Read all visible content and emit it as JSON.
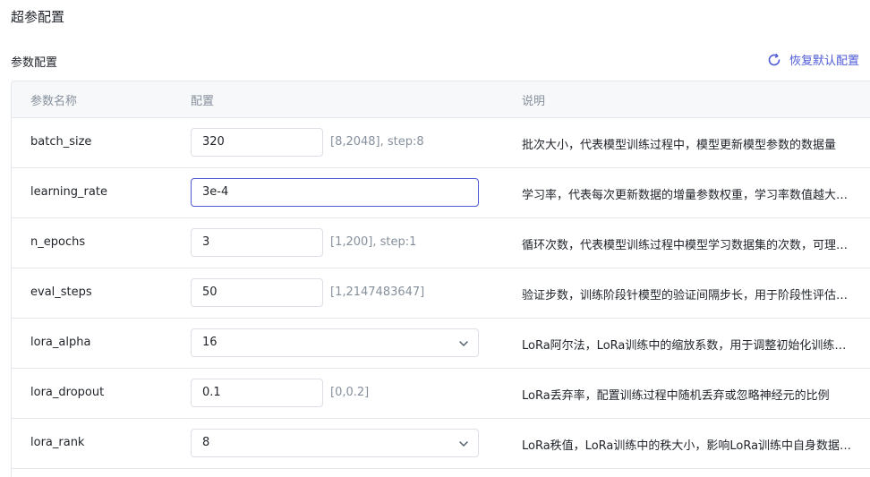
{
  "page": {
    "title": "超参配置"
  },
  "section": {
    "title": "参数配置",
    "restore_label": "恢复默认配置"
  },
  "table": {
    "headers": {
      "name": "参数名称",
      "config": "配置",
      "desc": "说明"
    },
    "rows": [
      {
        "name": "batch_size",
        "type": "input",
        "value": "320",
        "range": "[8,2048], step:8",
        "desc": "批次大小，代表模型训练过程中，模型更新模型参数的数据量"
      },
      {
        "name": "learning_rate",
        "type": "input",
        "value": "3e-4",
        "range": "",
        "desc": "学习率，代表每次更新数据的增量参数权重，学习率数值越大参数变化越大"
      },
      {
        "name": "n_epochs",
        "type": "input",
        "value": "3",
        "range": "[1,200], step:1",
        "desc": "循环次数，代表模型训练过程中模型学习数据集的次数，可理解为看几遍数据"
      },
      {
        "name": "eval_steps",
        "type": "input",
        "value": "50",
        "range": "[1,2147483647]",
        "desc": "验证步数，训练阶段针模型的验证间隔步长，用于阶段性评估模型训练准确率"
      },
      {
        "name": "lora_alpha",
        "type": "select",
        "value": "16",
        "range": "",
        "desc": "LoRa阿尔法，LoRa训练中的缩放系数，用于调整初始化训练权重"
      },
      {
        "name": "lora_dropout",
        "type": "input",
        "value": "0.1",
        "range": "[0,0.2]",
        "desc": "LoRa丢弃率，配置训练过程中随机丢弃或忽略神经元的比例"
      },
      {
        "name": "lora_rank",
        "type": "select",
        "value": "8",
        "range": "",
        "desc": "LoRa秩值，LoRa训练中的秩大小，影响LoRa训练中自身数据对模型的影响"
      }
    ]
  }
}
